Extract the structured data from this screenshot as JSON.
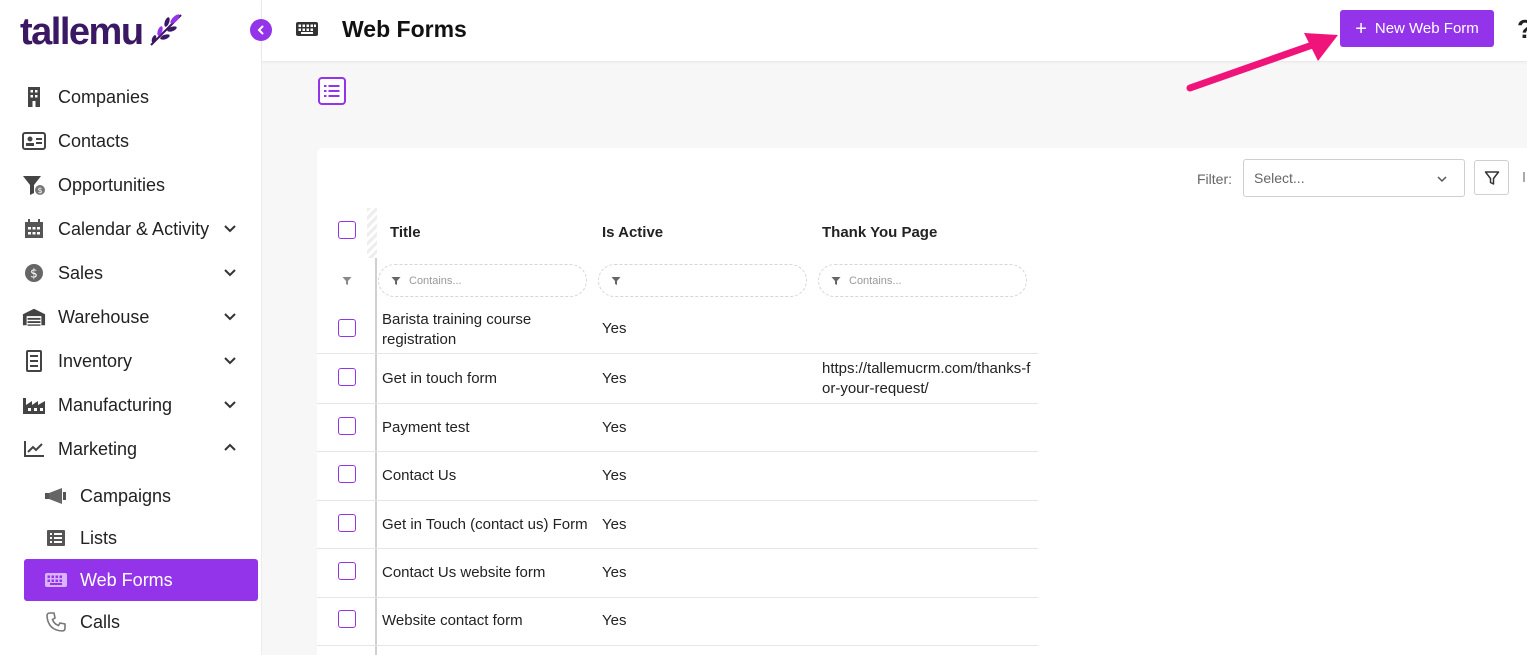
{
  "app": {
    "logo_text": "tallemu"
  },
  "sidebar": {
    "items": [
      {
        "label": "Companies",
        "icon": "building-icon"
      },
      {
        "label": "Contacts",
        "icon": "contact-card-icon"
      },
      {
        "label": "Opportunities",
        "icon": "funnel-dollar-icon"
      },
      {
        "label": "Calendar & Activity",
        "icon": "calendar-icon",
        "expandable": true
      },
      {
        "label": "Sales",
        "icon": "dollar-coin-icon",
        "expandable": true
      },
      {
        "label": "Warehouse",
        "icon": "warehouse-icon",
        "expandable": true
      },
      {
        "label": "Inventory",
        "icon": "inventory-list-icon",
        "expandable": true
      },
      {
        "label": "Manufacturing",
        "icon": "factory-icon",
        "expandable": true
      },
      {
        "label": "Marketing",
        "icon": "chart-line-icon",
        "expandable": true,
        "expanded": true
      }
    ],
    "sub_items": [
      {
        "label": "Campaigns",
        "icon": "megaphone-icon"
      },
      {
        "label": "Lists",
        "icon": "list-icon"
      },
      {
        "label": "Web Forms",
        "icon": "keyboard-icon",
        "active": true
      },
      {
        "label": "Calls",
        "icon": "phone-icon"
      }
    ]
  },
  "header": {
    "title": "Web Forms",
    "new_button_plus": "+",
    "new_button_label": "New Web Form",
    "help_glyph": "?"
  },
  "toolbar": {
    "filter_label": "Filter:",
    "filter_placeholder": "Select..."
  },
  "table": {
    "columns": [
      "Title",
      "Is Active",
      "Thank You Page"
    ],
    "filter_placeholder": "Contains...",
    "rows": [
      {
        "title": "Barista training course registration",
        "active": "Yes",
        "thanks": ""
      },
      {
        "title": "Get in touch form",
        "active": "Yes",
        "thanks": "https://tallemucrm.com/thanks-for-your-request/"
      },
      {
        "title": "Payment test",
        "active": "Yes",
        "thanks": ""
      },
      {
        "title": "Contact Us",
        "active": "Yes",
        "thanks": ""
      },
      {
        "title": "Get in Touch (contact us) Form",
        "active": "Yes",
        "thanks": ""
      },
      {
        "title": "Contact Us website form",
        "active": "Yes",
        "thanks": ""
      },
      {
        "title": "Website contact form",
        "active": "Yes",
        "thanks": ""
      }
    ]
  },
  "colors": {
    "accent": "#9333ea",
    "logo": "#3a1863",
    "annotation_arrow": "#f0147a"
  }
}
